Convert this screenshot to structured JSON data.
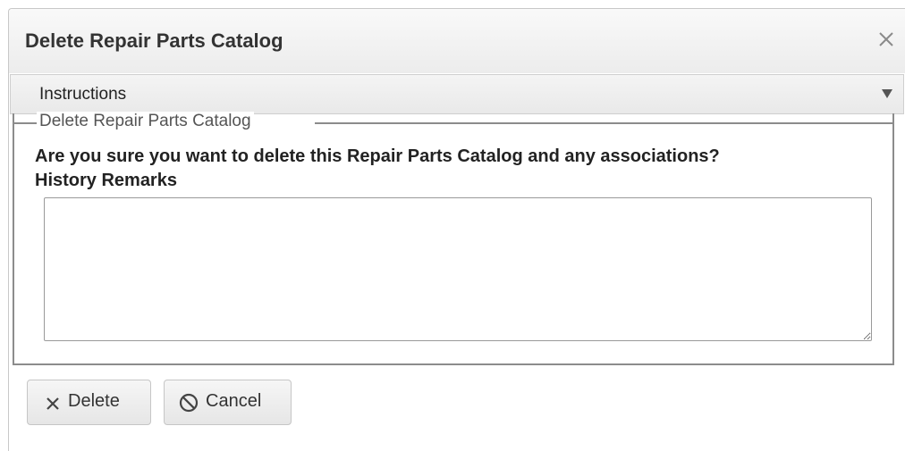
{
  "dialog": {
    "title": "Delete Repair Parts Catalog",
    "close_icon": "close-icon"
  },
  "instructions": {
    "label": "Instructions",
    "toggle_icon": "chevron-down-icon"
  },
  "form": {
    "group_legend": "Delete Repair Parts Catalog",
    "confirm_message": "Are you sure you want to delete this Repair Parts Catalog and any associations?",
    "history_remarks_label": "History Remarks",
    "history_remarks_value": ""
  },
  "actions": {
    "delete_label": "Delete",
    "delete_icon": "x-icon",
    "cancel_label": "Cancel",
    "cancel_icon": "prohibited-icon"
  }
}
